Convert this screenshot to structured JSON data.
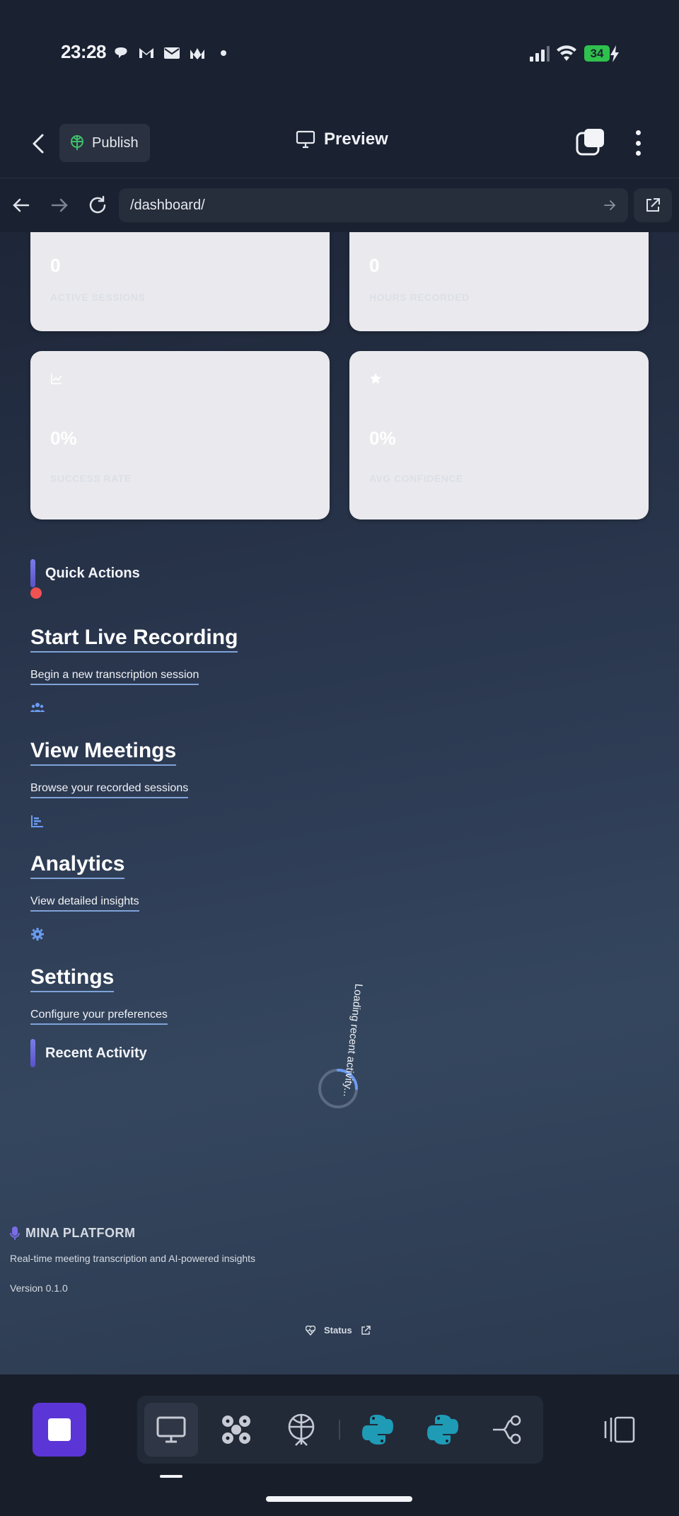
{
  "status_bar": {
    "time": "23:28",
    "notification_icons": [
      "app-icon",
      "gmail-icon",
      "mail-icon",
      "gmail-icon",
      "dot-icon"
    ],
    "battery": "34"
  },
  "header": {
    "publish_label": "Publish",
    "preview_label": "Preview"
  },
  "browser": {
    "url": "/dashboard/"
  },
  "stats": [
    {
      "value": "0",
      "label": "ACTIVE SESSIONS"
    },
    {
      "value": "0",
      "label": "HOURS RECORDED"
    },
    {
      "value": "0%",
      "label": "SUCCESS RATE",
      "icon": "chart-line-icon"
    },
    {
      "value": "0%",
      "label": "AVG CONFIDENCE",
      "icon": "star-icon"
    }
  ],
  "quick_actions": {
    "title": "Quick Actions",
    "items": [
      {
        "title": "Start Live Recording",
        "description": "Begin a new transcription session",
        "icon": "record-dot-icon",
        "color": "#f05252"
      },
      {
        "title": "View Meetings",
        "description": "Browse your recorded sessions",
        "icon": "users-icon",
        "color": "#6b9bf2"
      },
      {
        "title": "Analytics",
        "description": "View detailed insights",
        "icon": "bar-chart-icon",
        "color": "#6b9bf2"
      },
      {
        "title": "Settings",
        "description": "Configure your preferences",
        "icon": "gear-icon",
        "color": "#6b9bf2"
      }
    ]
  },
  "recent_activity": {
    "title": "Recent Activity",
    "loading_text": "Loading recent activity..."
  },
  "footer": {
    "brand": "MINA PLATFORM",
    "tagline": "Real-time meeting transcription and AI-powered insights",
    "version": "Version 0.1.0",
    "status_label": "Status"
  },
  "toolbar": {
    "tools": [
      "monitor-icon",
      "apps-icon",
      "publish-icon",
      "python-icon",
      "python-icon",
      "branch-icon",
      "panel-icon"
    ]
  },
  "colors": {
    "accent": "#5b35d5",
    "link_underline": "#7fa2d8",
    "battery": "#2fc14d"
  }
}
